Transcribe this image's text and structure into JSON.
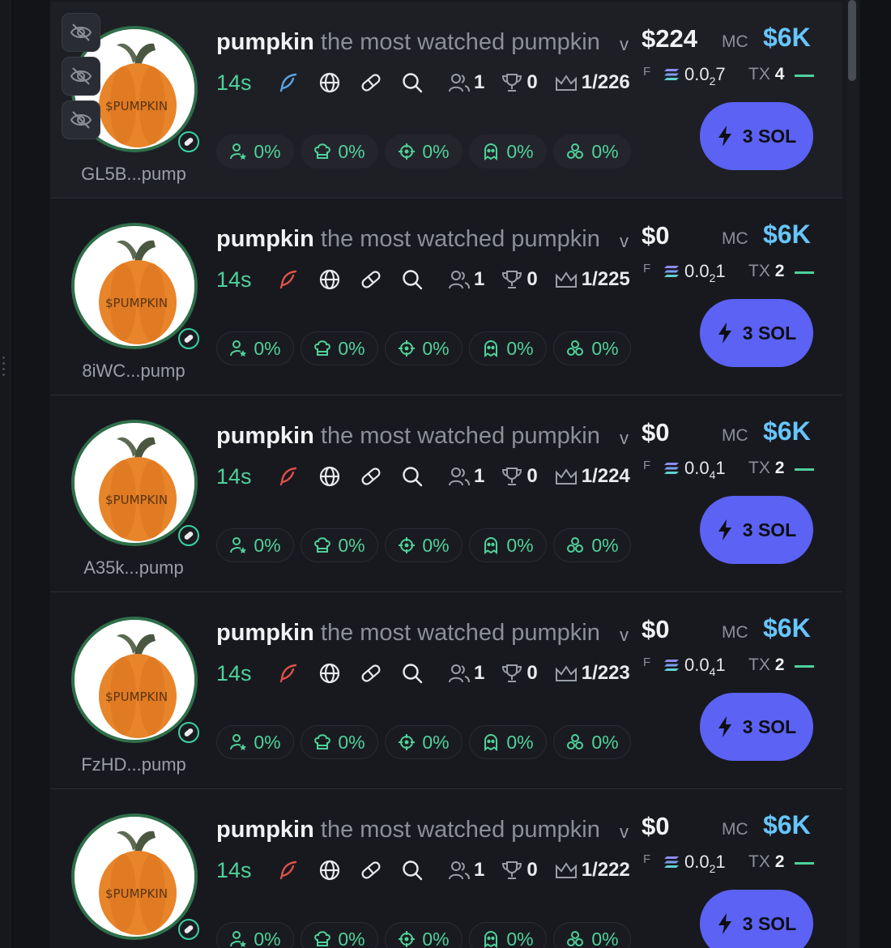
{
  "colors": {
    "background": "#131418",
    "panel": "#18191e",
    "accent_green": "#4fd19a",
    "accent_blue": "#66c6ff",
    "buy_button": "#5b62f4",
    "twitter_blue": "#5aa6e8",
    "twitter_red": "#e0504a"
  },
  "tokens": [
    {
      "name": "pumpkin",
      "description": "the most watched pumpkin",
      "caret": "v",
      "volume": "$224",
      "mc_label": "MC",
      "mc_value": "$6K",
      "age": "14s",
      "feather_color": "#5aa6e8",
      "holders": "1",
      "trophies": "0",
      "rank": "1/226",
      "f_label": "F",
      "sol_main": "0.0",
      "sol_sub": "2",
      "sol_tail": "7",
      "tx_label": "TX",
      "tx_count": "4",
      "chips": [
        "0%",
        "0%",
        "0%",
        "0%",
        "0%"
      ],
      "buy_label": "3 SOL",
      "address": "GL5B...pump",
      "hide_buttons": [
        "eye-off-icon",
        "eye-off-icon",
        "eye-off-icon"
      ]
    },
    {
      "name": "pumpkin",
      "description": "the most watched pumpkin",
      "caret": "v",
      "volume": "$0",
      "mc_label": "MC",
      "mc_value": "$6K",
      "age": "14s",
      "feather_color": "#e0504a",
      "holders": "1",
      "trophies": "0",
      "rank": "1/225",
      "f_label": "F",
      "sol_main": "0.0",
      "sol_sub": "2",
      "sol_tail": "1",
      "tx_label": "TX",
      "tx_count": "2",
      "chips": [
        "0%",
        "0%",
        "0%",
        "0%",
        "0%"
      ],
      "buy_label": "3 SOL",
      "address": "8iWC...pump"
    },
    {
      "name": "pumpkin",
      "description": "the most watched pumpkin",
      "caret": "v",
      "volume": "$0",
      "mc_label": "MC",
      "mc_value": "$6K",
      "age": "14s",
      "feather_color": "#e0504a",
      "holders": "1",
      "trophies": "0",
      "rank": "1/224",
      "f_label": "F",
      "sol_main": "0.0",
      "sol_sub": "4",
      "sol_tail": "1",
      "tx_label": "TX",
      "tx_count": "2",
      "chips": [
        "0%",
        "0%",
        "0%",
        "0%",
        "0%"
      ],
      "buy_label": "3 SOL",
      "address": "A35k...pump"
    },
    {
      "name": "pumpkin",
      "description": "the most watched pumpkin",
      "caret": "v",
      "volume": "$0",
      "mc_label": "MC",
      "mc_value": "$6K",
      "age": "14s",
      "feather_color": "#e0504a",
      "holders": "1",
      "trophies": "0",
      "rank": "1/223",
      "f_label": "F",
      "sol_main": "0.0",
      "sol_sub": "4",
      "sol_tail": "1",
      "tx_label": "TX",
      "tx_count": "2",
      "chips": [
        "0%",
        "0%",
        "0%",
        "0%",
        "0%"
      ],
      "buy_label": "3 SOL",
      "address": "FzHD...pump"
    },
    {
      "name": "pumpkin",
      "description": "the most watched pumpkin",
      "caret": "v",
      "volume": "$0",
      "mc_label": "MC",
      "mc_value": "$6K",
      "age": "14s",
      "feather_color": "#e0504a",
      "holders": "1",
      "trophies": "0",
      "rank": "1/222",
      "f_label": "F",
      "sol_main": "0.0",
      "sol_sub": "2",
      "sol_tail": "1",
      "tx_label": "TX",
      "tx_count": "2",
      "chips": [
        "0%",
        "0%",
        "0%",
        "0%",
        "0%"
      ],
      "buy_label": "3 SOL",
      "address": ""
    }
  ],
  "avatar_text": "$PUMPKIN",
  "chip_icons": [
    "top-holders-icon",
    "dev-holding-icon",
    "snipers-icon",
    "insiders-icon",
    "bundles-icon"
  ]
}
